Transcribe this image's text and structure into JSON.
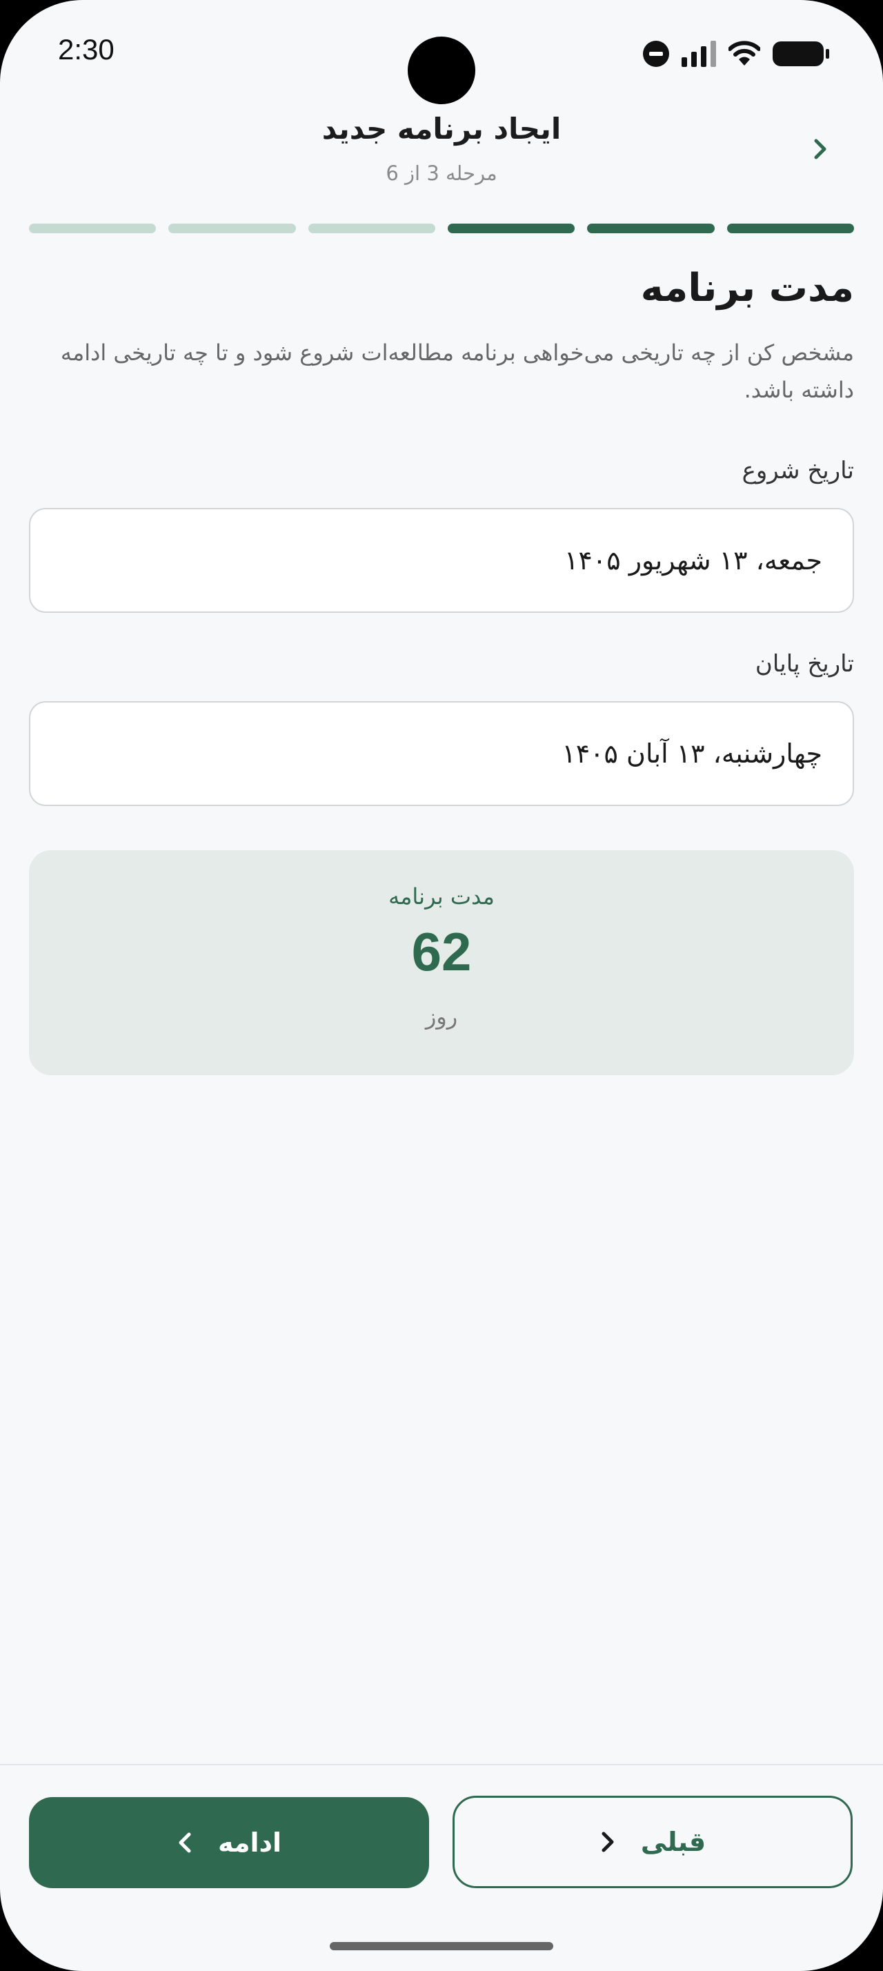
{
  "status_bar": {
    "time": "2:30"
  },
  "header": {
    "title": "ایجاد برنامه جدید",
    "subtitle": "مرحله 3 از 6"
  },
  "progress": {
    "total_steps": 6,
    "completed_steps": 3
  },
  "step": {
    "title": "مدت برنامه",
    "description": "مشخص کن از چه تاریخی می‌خواهی برنامه مطالعه‌ات شروع شود و تا چه تاریخی ادامه داشته باشد."
  },
  "start_date": {
    "label": "تاریخ شروع",
    "value": "جمعه، ۱۳ شهریور ۱۴۰۵"
  },
  "end_date": {
    "label": "تاریخ پایان",
    "value": "چهارشنبه، ۱۳ آبان ۱۴۰۵"
  },
  "duration": {
    "label": "مدت برنامه",
    "value": "62",
    "unit": "روز"
  },
  "buttons": {
    "next_label": "ادامه",
    "prev_label": "قبلی"
  },
  "colors": {
    "accent": "#2f6a50",
    "progress_inactive": "#c5dbd2",
    "summary_bg": "#e5ebe8"
  }
}
